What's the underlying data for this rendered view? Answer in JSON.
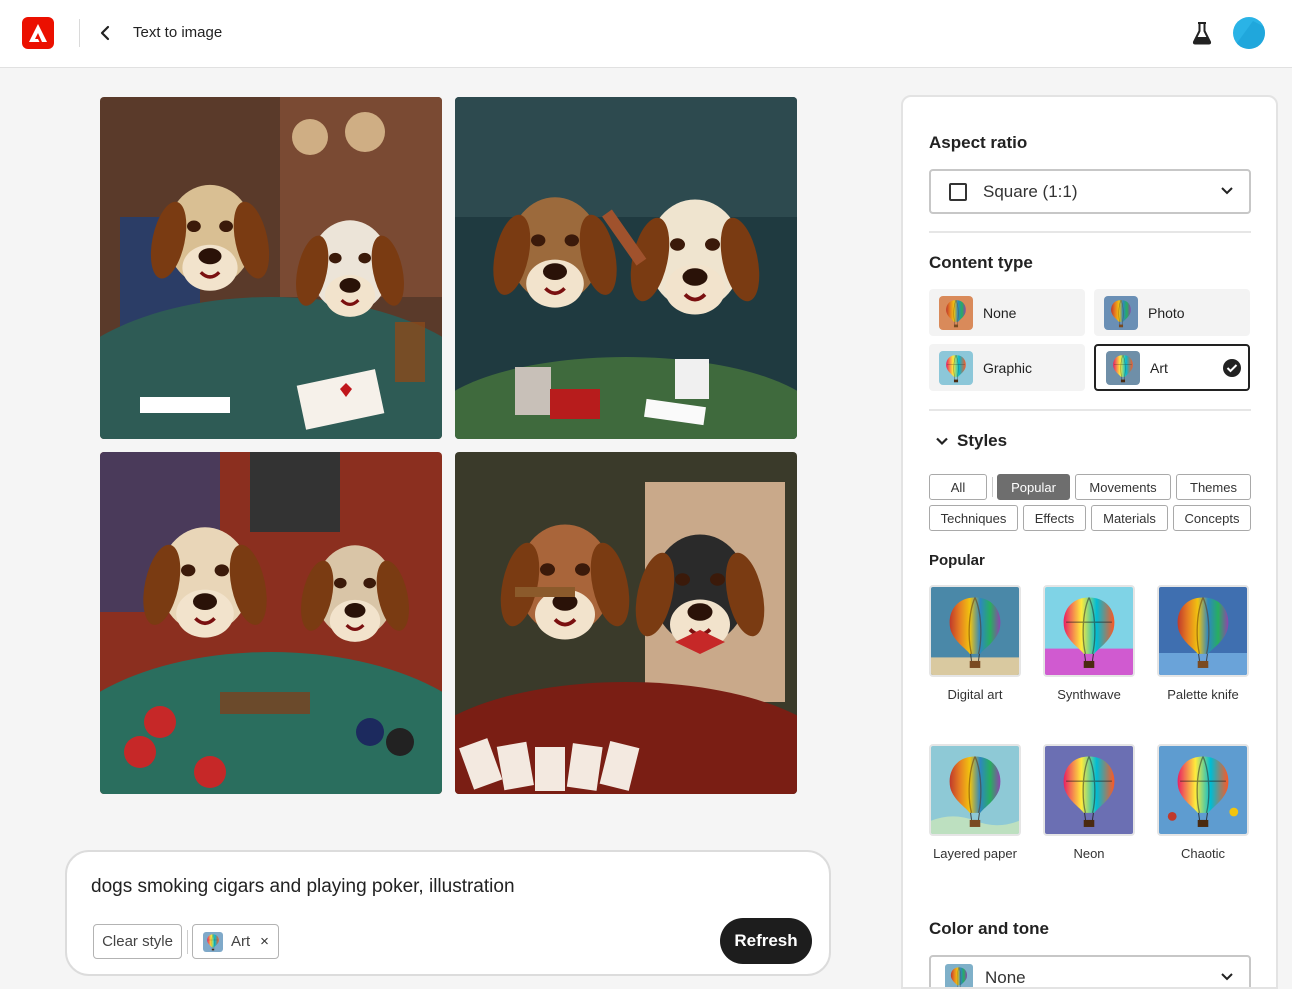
{
  "header": {
    "title": "Text to image",
    "logo_icon": "adobe-firefly-logo",
    "back_icon": "chevron-left-icon",
    "labs_icon": "flask-icon",
    "avatar_color": "#2ab3e6"
  },
  "gallery": {
    "images": [
      {
        "label": "dogs-playing-poker-1"
      },
      {
        "label": "dogs-playing-poker-2"
      },
      {
        "label": "dogs-playing-poker-3"
      },
      {
        "label": "dogs-playing-poker-4"
      }
    ]
  },
  "prompt": {
    "text": "dogs smoking cigars and playing poker, illustration",
    "clear_style_label": "Clear style",
    "applied_style_label": "Art",
    "remove_icon": "×",
    "refresh_label": "Refresh"
  },
  "panel": {
    "aspect_ratio": {
      "title": "Aspect ratio",
      "value": "Square (1:1)"
    },
    "content_type": {
      "title": "Content type",
      "options": [
        {
          "label": "None",
          "selected": false
        },
        {
          "label": "Photo",
          "selected": false
        },
        {
          "label": "Graphic",
          "selected": false
        },
        {
          "label": "Art",
          "selected": true
        }
      ]
    },
    "styles": {
      "title": "Styles",
      "tabs": [
        {
          "label": "All",
          "active": false
        },
        {
          "label": "Popular",
          "active": true
        },
        {
          "label": "Movements",
          "active": false
        },
        {
          "label": "Themes",
          "active": false
        },
        {
          "label": "Techniques",
          "active": false
        },
        {
          "label": "Effects",
          "active": false
        },
        {
          "label": "Materials",
          "active": false
        },
        {
          "label": "Concepts",
          "active": false
        }
      ],
      "section_title": "Popular",
      "items": [
        {
          "label": "Digital art"
        },
        {
          "label": "Synthwave"
        },
        {
          "label": "Palette knife"
        },
        {
          "label": "Layered paper"
        },
        {
          "label": "Neon"
        },
        {
          "label": "Chaotic"
        }
      ]
    },
    "color_and_tone": {
      "title": "Color and tone",
      "value": "None"
    }
  },
  "colors": {
    "brand_red": "#eb1000",
    "refresh_bg": "#1d1d1d",
    "active_tab": "#6e6e6e"
  }
}
